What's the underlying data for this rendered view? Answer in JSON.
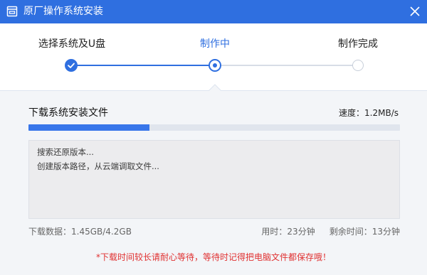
{
  "window": {
    "title": "原厂操作系统安装"
  },
  "colors": {
    "accent": "#2f6fe0",
    "warning": "#e03131"
  },
  "icons": {
    "title": "window-icon",
    "close": "close-icon",
    "done_step": "check-icon"
  },
  "steps": [
    {
      "label": "选择系统及U盘",
      "state": "done"
    },
    {
      "label": "制作中",
      "state": "current"
    },
    {
      "label": "制作完成",
      "state": "todo"
    }
  ],
  "task": {
    "title": "下载系统安装文件",
    "speed_label": "速度：",
    "speed_value": "1.2MB/s",
    "progress_fraction": 0.325
  },
  "log": [
    "搜索还原版本...",
    "创建版本路径，从云端调取文件..."
  ],
  "stats": {
    "downloaded_label": "下载数据：",
    "downloaded_value": "1.45GB/4.2GB",
    "elapsed_label": "用时：",
    "elapsed_value": "23分钟",
    "remaining_label": "剩余时间：",
    "remaining_value": "13分钟"
  },
  "warning": "*下载时间较长请耐心等待，等待时记得把电脑文件都保存哦！"
}
